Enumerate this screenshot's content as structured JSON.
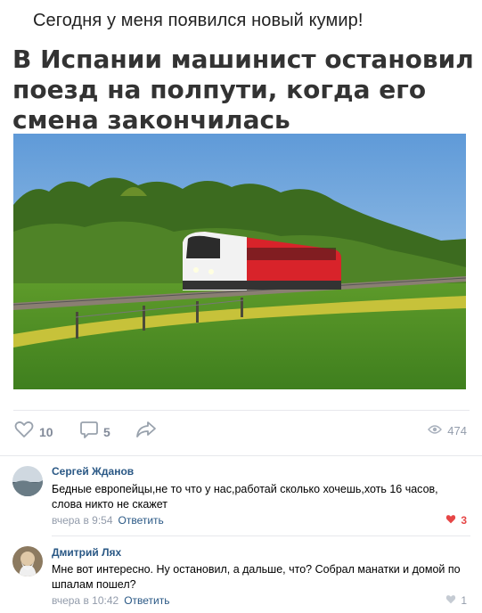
{
  "caption": "Сегодня у меня появился новый кумир!",
  "post": {
    "headline": "В Испании машинист остановил поезд на полпути, когда его смена закончилась"
  },
  "actions": {
    "likes": "10",
    "comments": "5",
    "views": "474"
  },
  "comments": [
    {
      "author": "Сергей Жданов",
      "text": "Бедные европейцы,не то что у нас,работай сколько хочешь,хоть 16 часов, слова никто не скажет",
      "time": "вчера в 9:54",
      "reply_label": "Ответить",
      "likes": "3",
      "liked": true
    },
    {
      "author": "Дмитрий Лях",
      "text": "Мне вот интересно. Ну остановил, а дальше, что? Собрал манатки и домой по шпалам пошел?",
      "time": "вчера в 10:42",
      "reply_label": "Ответить",
      "likes": "1",
      "liked": false
    }
  ],
  "colors": {
    "link": "#2a5885",
    "muted": "#939cab",
    "like_active": "#e64646",
    "train_red": "#d8232a"
  },
  "icons": [
    "heart-icon",
    "comment-icon",
    "share-icon",
    "eye-icon"
  ]
}
